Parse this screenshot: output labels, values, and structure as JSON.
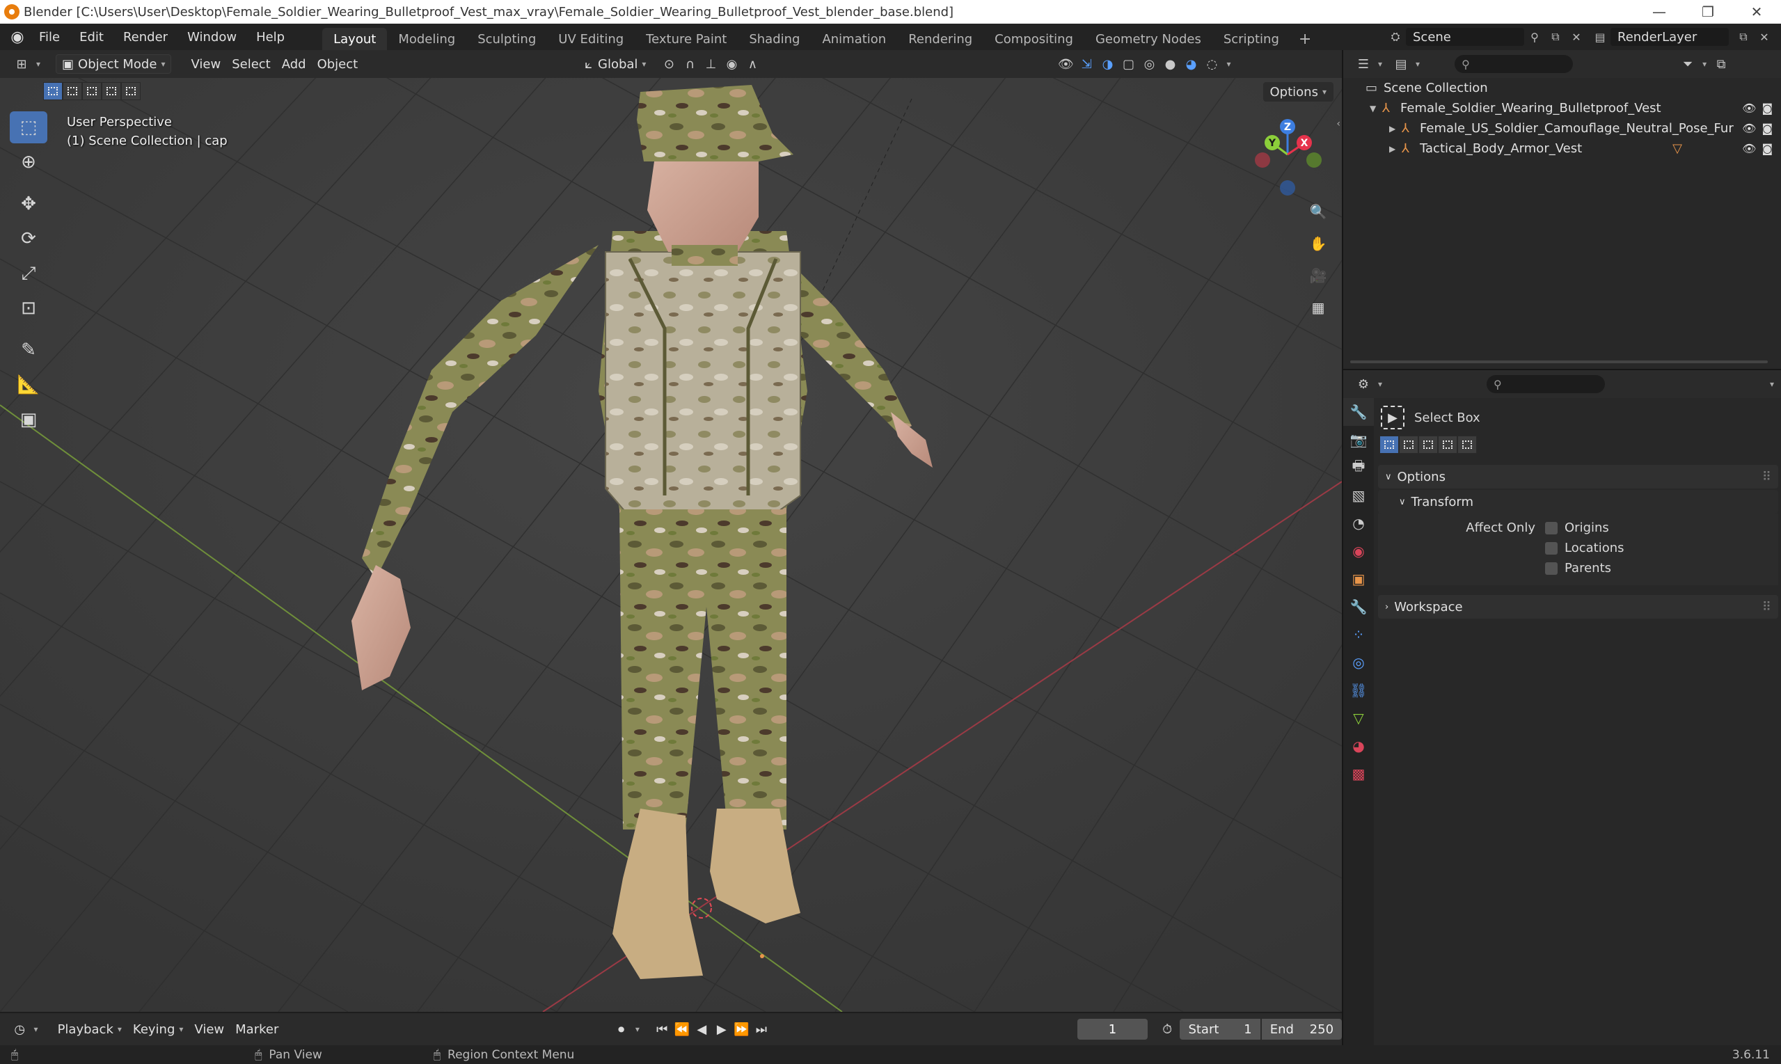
{
  "window": {
    "title": "Blender [C:\\Users\\User\\Desktop\\Female_Soldier_Wearing_Bulletproof_Vest_max_vray\\Female_Soldier_Wearing_Bulletproof_Vest_blender_base.blend]",
    "minimize": "—",
    "restore": "❐",
    "close": "✕"
  },
  "menu": {
    "file": "File",
    "edit": "Edit",
    "render": "Render",
    "window": "Window",
    "help": "Help"
  },
  "workspaces": [
    "Layout",
    "Modeling",
    "Sculpting",
    "UV Editing",
    "Texture Paint",
    "Shading",
    "Animation",
    "Rendering",
    "Compositing",
    "Geometry Nodes",
    "Scripting"
  ],
  "workspace_add": "+",
  "scene": {
    "name": "Scene",
    "render_layer": "RenderLayer"
  },
  "viewport_header": {
    "mode": "Object Mode",
    "view": "View",
    "select": "Select",
    "add": "Add",
    "object": "Object",
    "orientation": "Global",
    "options": "Options"
  },
  "viewport": {
    "perspective": "User Perspective",
    "collection_info": "(1) Scene Collection | cap",
    "gizmo": {
      "z": "Z",
      "y": "Y",
      "x": "X"
    }
  },
  "outliner": {
    "root": "Scene Collection",
    "items": [
      {
        "label": "Female_Soldier_Wearing_Bulletproof_Vest",
        "depth": 1,
        "expanded": true
      },
      {
        "label": "Female_US_Soldier_Camouflage_Neutral_Pose_Fur",
        "depth": 2,
        "expanded": false
      },
      {
        "label": "Tactical_Body_Armor_Vest",
        "depth": 2,
        "expanded": false
      }
    ]
  },
  "properties": {
    "tool_name": "Select Box",
    "options_label": "Options",
    "transform_label": "Transform",
    "affect_only_label": "Affect Only",
    "affect_only": [
      {
        "label": "Origins",
        "checked": false
      },
      {
        "label": "Locations",
        "checked": false
      },
      {
        "label": "Parents",
        "checked": false
      }
    ],
    "workspace_label": "Workspace"
  },
  "timeline": {
    "playback": "Playback",
    "keying": "Keying",
    "view": "View",
    "marker": "Marker",
    "current_frame": "1",
    "start_label": "Start",
    "start": "1",
    "end_label": "End",
    "end": "250"
  },
  "statusbar": {
    "pan_view": "Pan View",
    "region_context_menu": "Region Context Menu",
    "version": "3.6.11"
  },
  "colors": {
    "accent": "#4772b3",
    "x_axis": "#e6334c",
    "y_axis": "#8ccf3a",
    "z_axis": "#3d7ee0",
    "object_orange": "#e8954a"
  }
}
